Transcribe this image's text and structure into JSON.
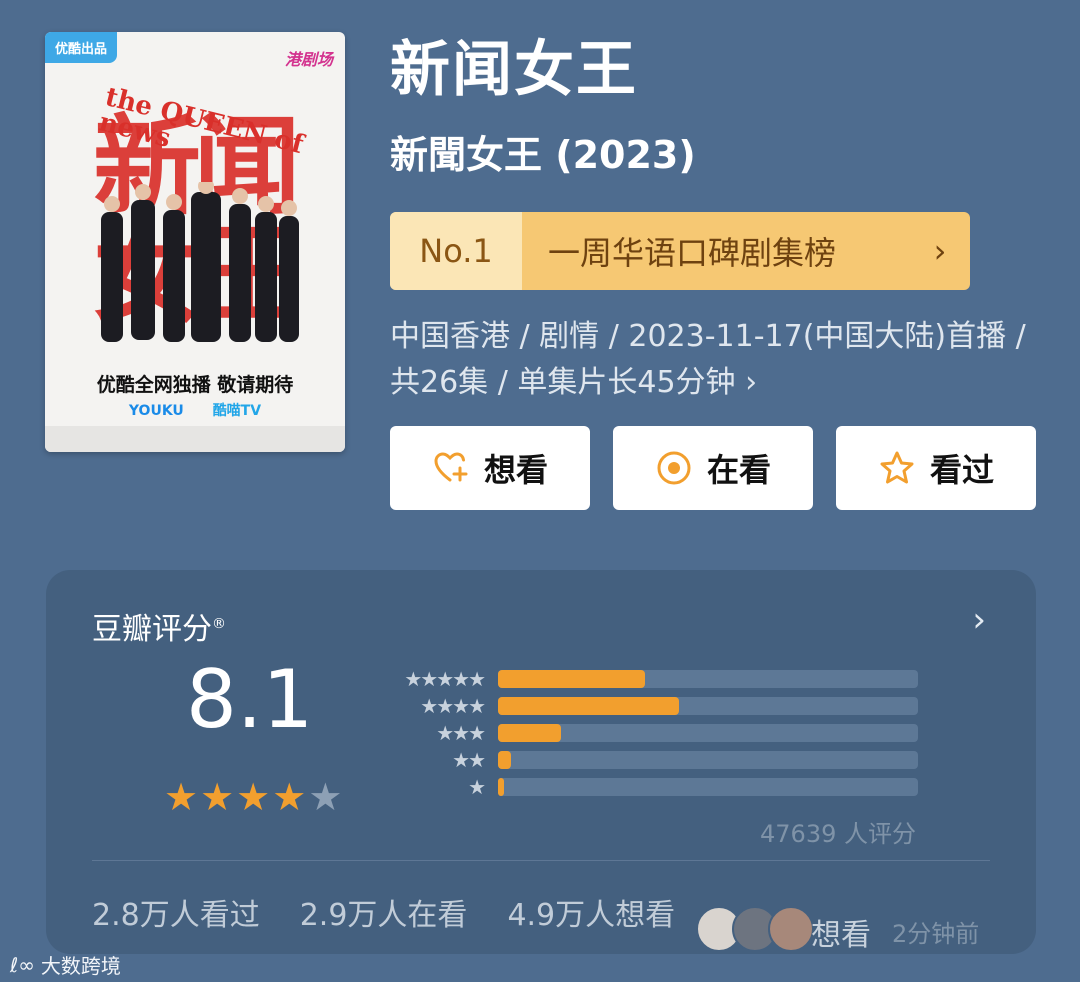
{
  "poster": {
    "tag": "优酷出品",
    "brand": "港剧场",
    "english_title": "the QUEEN of news",
    "big_title": "新闻女王",
    "slogan": "优酷全网独播 敬请期待",
    "platform_1": "YOUKU",
    "platform_2": "酷喵TV"
  },
  "header": {
    "title": "新闻女王",
    "subtitle": "新聞女王 (2023)"
  },
  "rank": {
    "no": "No.1",
    "label": "一周华语口碑剧集榜",
    "chevron": "›"
  },
  "meta": {
    "line": "中国香港 / 剧情 / 2023-11-17(中国大陆)首播 / 共26集 / 单集片长45分钟 ›"
  },
  "actions": {
    "want": "想看",
    "watching": "在看",
    "watched": "看过"
  },
  "rating": {
    "header": "豆瓣评分",
    "reg": "®",
    "chevron": "›",
    "score": "8.1",
    "star_fill": 4,
    "star_total": 5,
    "distribution": [
      {
        "stars": "★★★★★",
        "percent": 0.35
      },
      {
        "stars": "★★★★",
        "percent": 0.43
      },
      {
        "stars": "★★★",
        "percent": 0.15
      },
      {
        "stars": "★★",
        "percent": 0.03
      },
      {
        "stars": "★",
        "percent": 0.01
      }
    ],
    "count_text": "47639 人评分",
    "stats": {
      "watched": "2.8万人看过",
      "watching": "2.9万人在看",
      "want": "4.9万人想看"
    },
    "recent_action": "想看",
    "recent_time": "2分钟前"
  },
  "watermark": "大数跨境",
  "colors": {
    "background": "#4e6c8f",
    "card": "#44607f",
    "accent": "#f29f2e",
    "rank_badge": "#f6c873"
  }
}
